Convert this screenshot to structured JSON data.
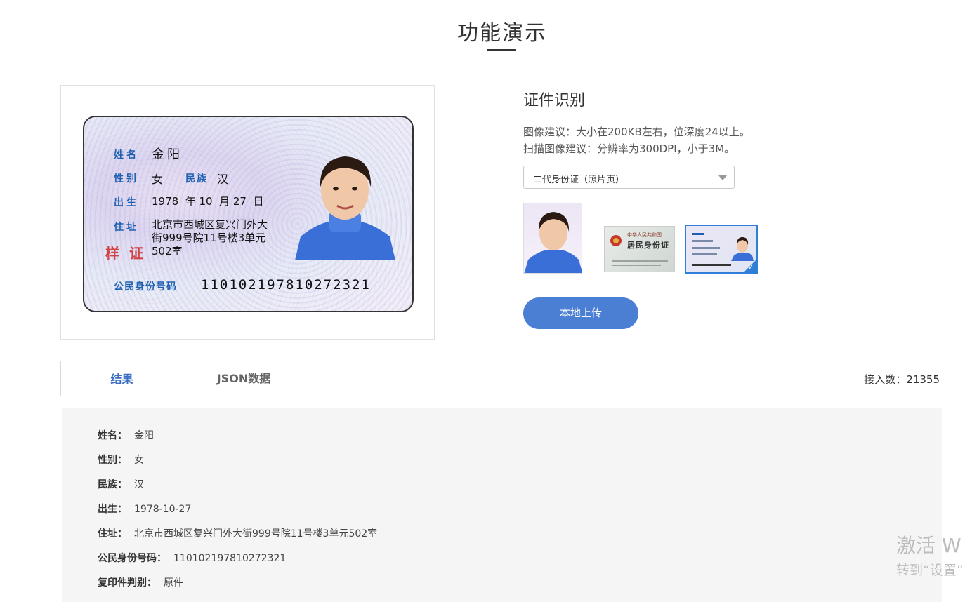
{
  "page": {
    "title": "功能演示"
  },
  "id_card": {
    "name_label": "姓名",
    "name_value": "金阳",
    "gender_label": "性别",
    "gender_value": "女",
    "ethnicity_label": "民族",
    "ethnicity_value": "汉",
    "birth_label": "出生",
    "birth_value": "1978  年 10  月 27  日",
    "address_label": "住址",
    "address_line1": "北京市西城区复兴门外大",
    "address_line2": "街999号院11号楼3单元",
    "address_line3": "502室",
    "stamp": "样证",
    "id_label": "公民身份号码",
    "id_value": "110102197810272321"
  },
  "panel": {
    "title": "证件识别",
    "hint1": "图像建议：大小在200KB左右，位深度24以上。",
    "hint2": "扫描图像建议：分辨率为300DPI，小于3M。",
    "select_value": "二代身份证（照片页）",
    "thumb2_text1": "中华人民共和国",
    "thumb2_text2": "居民身份证",
    "upload_label": "本地上传"
  },
  "tabs": {
    "result": "结果",
    "json": "JSON数据",
    "access_count": "接入数：21355"
  },
  "result": [
    {
      "label": "姓名：",
      "value": "金阳"
    },
    {
      "label": "性别：",
      "value": "女"
    },
    {
      "label": "民族：",
      "value": "汉"
    },
    {
      "label": "出生：",
      "value": "1978-10-27"
    },
    {
      "label": "住址：",
      "value": "北京市西城区复兴门外大街999号院11号楼3单元502室"
    },
    {
      "label": "公民身份号码：",
      "value": "110102197810272321"
    },
    {
      "label": "复印件判别：",
      "value": "原件"
    }
  ],
  "watermark": {
    "line1": "激活 W",
    "line2": "转到“设置”"
  },
  "colors": {
    "accent": "#4a7fd4",
    "tab_active": "#3a6cc2",
    "card_label": "#1f5fb0"
  }
}
